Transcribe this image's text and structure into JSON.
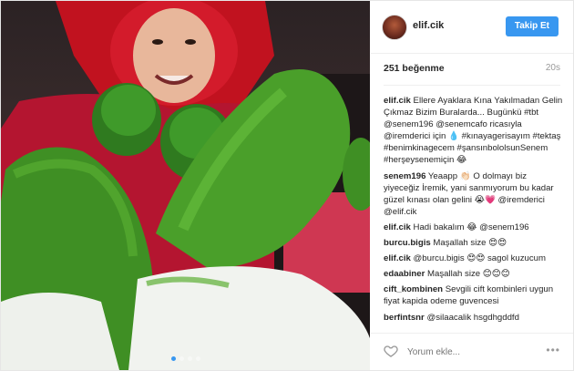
{
  "header": {
    "username": "elif.cik",
    "follow_label": "Takip Et"
  },
  "meta": {
    "likes": "251 beğenme",
    "time": "20s"
  },
  "comments": [
    {
      "user": "elif.cik",
      "text": "Ellere Ayaklara Kına Yakılmadan Gelin Çıkmaz Bizim Buralarda... Bugünkü #tbt @senem196 @senemcafo ricasıyla @iremderici için 💧 #kınayagerisayım #tektaş #benimkinagecem #şansınbololsunSenem #herşeysenemiçin 😂"
    },
    {
      "user": "senem196",
      "text": "Yeaapp 👏🏻 O dolmayı biz yiyeceğiz İremik, yani sanmıyorum bu kadar güzel kınası olan gelini 😭💗 @iremderici @elif.cik"
    },
    {
      "user": "elif.cik",
      "text": "Hadi bakalım 😂 @senem196"
    },
    {
      "user": "burcu.bigis",
      "text": "Maşallah size 😍😍"
    },
    {
      "user": "elif.cik",
      "text": "@burcu.bigis 😍😍 sagol kuzucum"
    },
    {
      "user": "edaabiner",
      "text": "Maşallah size 😊😊😊"
    },
    {
      "user": "cift_kombinen",
      "text": "Sevgili cift kombinleri uygun fiyat kapida odeme guvencesi"
    },
    {
      "user": "berfintsnr",
      "text": "@silaacalik hsgdhgddfd"
    }
  ],
  "footer": {
    "comment_placeholder": "Yorum ekle...",
    "more_label": "•••"
  },
  "icons": {
    "heart": "heart-icon",
    "more": "more-options-icon"
  },
  "colors": {
    "accent": "#3897f0",
    "text": "#262626",
    "muted": "#999999"
  }
}
